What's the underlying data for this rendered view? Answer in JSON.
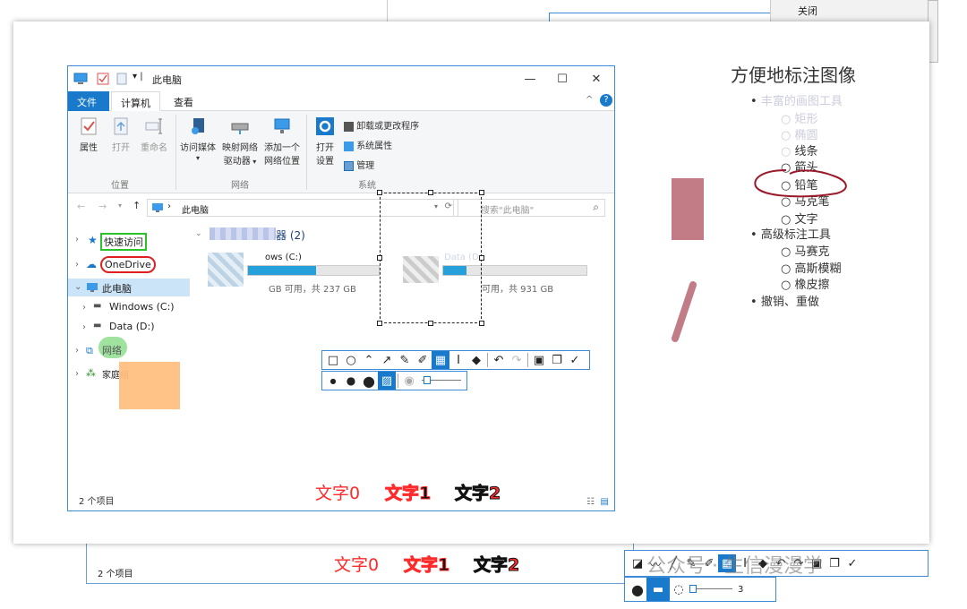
{
  "background": {
    "top_menu_item": "关闭",
    "bottom_status": "2 个项目",
    "bottom_texts": [
      "文字0",
      "文字1",
      "文字2"
    ],
    "bottom_slider_value": "3"
  },
  "explorer": {
    "title": "此电脑",
    "tabs": {
      "file": "文件",
      "computer": "计算机",
      "view": "查看"
    },
    "ribbon": {
      "location": {
        "properties": "属性",
        "open": "打开",
        "rename": "重命名",
        "group": "位置"
      },
      "network": {
        "media": "访问媒体",
        "map_drive_1": "映射网络",
        "map_drive_2": "驱动器",
        "add_loc_1": "添加一个",
        "add_loc_2": "网络位置",
        "group": "网络"
      },
      "system": {
        "open_settings_1": "打开",
        "open_settings_2": "设置",
        "uninstall": "卸载或更改程序",
        "sys_props": "系统属性",
        "manage": "管理",
        "group": "系统"
      }
    },
    "address": "此电脑",
    "search_placeholder": "搜索\"此电脑\"",
    "nav": {
      "quick_access": "快速访问",
      "onedrive": "OneDrive",
      "this_pc": "此电脑",
      "windows_c": "Windows (C:)",
      "data_d": "Data (D:)",
      "network": "网络",
      "homegroup": "家庭组"
    },
    "section_header": "器 (2)",
    "drives": [
      {
        "name": "ows (C:)",
        "free": "GB 可用，共 237 GB",
        "fill": 0.52
      },
      {
        "name": "Data (D:)",
        "free": "可用，共 931 GB",
        "fill": 0.16
      }
    ],
    "status": "2 个项目",
    "annotation_texts": [
      "文字0",
      "文字1",
      "文字2"
    ]
  },
  "right_panel": {
    "title": "方便地标注图像",
    "items": [
      {
        "label": "丰富的画图工具",
        "children": [
          "矩形",
          "椭圆",
          "线条",
          "箭头",
          "铅笔",
          "马克笔",
          "文字"
        ]
      },
      {
        "label": "高级标注工具",
        "children": [
          "马赛克",
          "高斯模糊",
          "橡皮擦"
        ]
      },
      {
        "label": "撤销、重做",
        "children": []
      }
    ]
  },
  "watermark": "公众号 · 生信漫漫学",
  "colors": {
    "accent": "#1979ca",
    "annotation_red": "#ff2a2a",
    "pink_rect": "#c27c86",
    "orange_rect": "#ffbe7d"
  }
}
